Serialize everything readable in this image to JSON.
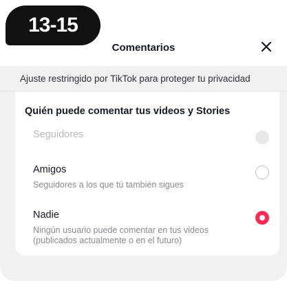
{
  "badge": {
    "text": "13-15"
  },
  "header": {
    "title": "Comentarios",
    "close_label": "close"
  },
  "restriction_note": "Ajuste restringido por TikTok para proteger tu privacidad",
  "section": {
    "heading": "Quién puede comentar tus videos y Stories",
    "options": [
      {
        "title": "Seguidores",
        "subtitle": "",
        "state": "disabled"
      },
      {
        "title": "Amigos",
        "subtitle": "Seguidores a los que tú también sigues",
        "state": "unselected"
      },
      {
        "title": "Nadie",
        "subtitle": "Ningún usuario puede comentar en tus videos (publicados actualmente o en el futuro)",
        "state": "selected"
      }
    ]
  },
  "colors": {
    "accent": "#fe2c55",
    "badge_bg": "#111111",
    "sheet_bg": "#f1f1f2"
  },
  "icons": {
    "close": "close-icon"
  }
}
